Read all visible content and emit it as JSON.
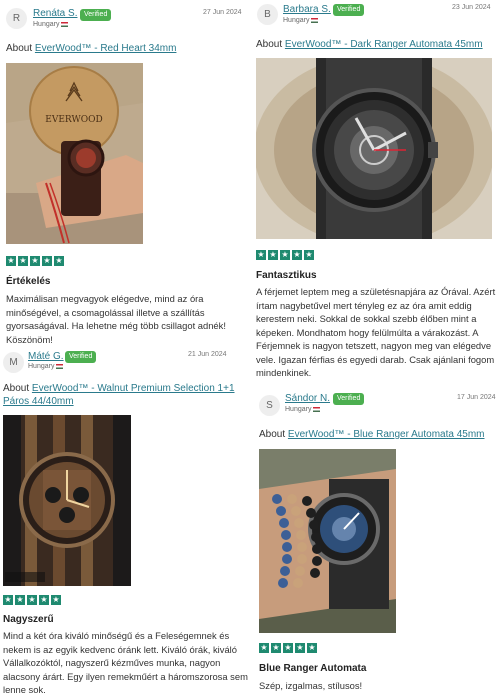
{
  "reviews": [
    {
      "avatar_letter": "R",
      "name": "Renáta S.",
      "verified": "Verified",
      "country": "Hungary",
      "date": "27 Jun 2024",
      "about_prefix": "About",
      "product": "EverWood™ - Red Heart 34mm",
      "stars": 5,
      "title": "Értékelés",
      "body": "Maximálisan megvagyok elégedve, mind az óra minőségével, a csomagolással illetve a szállítás gyorsaságával. Ha lehetne még több csillagot adnék! Köszönöm!",
      "photo_logo": "EVERWOOD"
    },
    {
      "avatar_letter": "B",
      "name": "Barbara S.",
      "verified": "Verified",
      "country": "Hungary",
      "date": "23 Jun 2024",
      "about_prefix": "About",
      "product": "EverWood™ - Dark Ranger Automata 45mm",
      "stars": 5,
      "title": "Fantasztikus",
      "body": "A férjemet leptem meg a születésnapjára az Órával. Azért írtam nagybetűvel mert tényleg ez az óra amit eddig kerestem neki. Sokkal de sokkal szebb élőben mint a képeken. Mondhatom hogy felülmúlta a várakozást. A Férjemnek is nagyon tetszett, nagyon meg van elégedve vele. Igazan férfias és egyedi darab. Csak ajánlani fogom mindenkinek."
    },
    {
      "avatar_letter": "M",
      "name": "Máté G.",
      "verified": "Verified",
      "country": "Hungary",
      "date": "21 Jun 2024",
      "about_prefix": "About",
      "product_line1": "EverWood™ - Walnut Premium Selection 1+1",
      "product_line2": "Páros 44/40mm",
      "stars": 5,
      "title": "Nagyszerű",
      "body": "Mind a két óra kiváló minőségű és a Feleségemnek és nekem is az egyik kedvenc óránk lett. Kiváló órák, kiváló Vállalkozóktól, nagyszerű kézműves munka, nagyon alacsony árárt. Egy ilyen remekműért a háromszorosa sem lenne sok."
    },
    {
      "avatar_letter": "S",
      "name": "Sándor N.",
      "verified": "Verified",
      "country": "Hungary",
      "date": "17 Jun 2024",
      "about_prefix": "About",
      "product": "EverWood™ - Blue Ranger Automata 45mm",
      "stars": 5,
      "title": "Blue Ranger Automata",
      "body": "Szép, izgalmas, stílusos!"
    }
  ],
  "star_glyph": "★",
  "colors": {
    "link": "#2a7a8c",
    "verified": "#4caf50",
    "star": "#1f8a70"
  }
}
